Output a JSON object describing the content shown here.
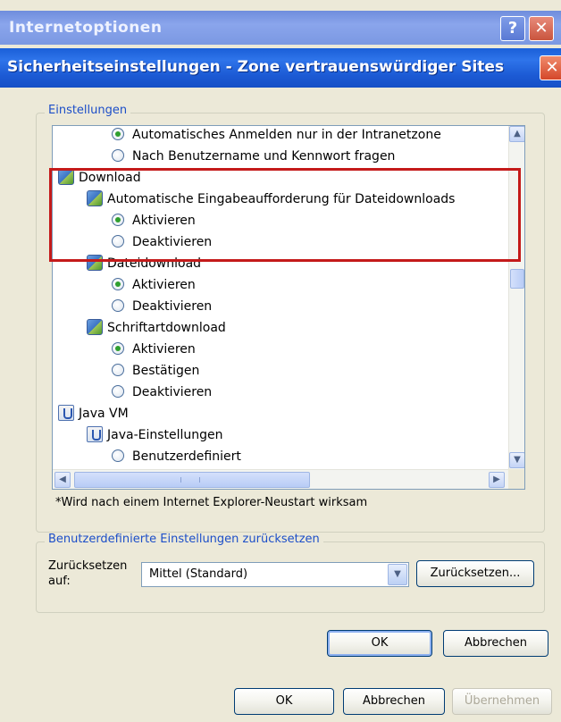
{
  "outer_window": {
    "title": "Internetoptionen",
    "help_label": "?",
    "close_label": "✕"
  },
  "dialog": {
    "title": "Sicherheitseinstellungen - Zone vertrauenswürdiger Sites",
    "close_label": "✕"
  },
  "settings_group": {
    "label": "Einstellungen",
    "rows": [
      {
        "kind": "radio",
        "checked": true,
        "label": "Automatisches Anmelden nur in der Intranetzone"
      },
      {
        "kind": "radio",
        "checked": false,
        "label": "Nach Benutzername und Kennwort fragen"
      },
      {
        "kind": "category",
        "icon": "settings-gear-icon",
        "label": "Download"
      },
      {
        "kind": "setting",
        "icon": "settings-gear-icon",
        "label": "Automatische Eingabeaufforderung für Dateidownloads"
      },
      {
        "kind": "radio",
        "checked": true,
        "label": "Aktivieren"
      },
      {
        "kind": "radio",
        "checked": false,
        "label": "Deaktivieren"
      },
      {
        "kind": "setting",
        "icon": "settings-gear-icon",
        "label": "Dateidownload"
      },
      {
        "kind": "radio",
        "checked": true,
        "label": "Aktivieren"
      },
      {
        "kind": "radio",
        "checked": false,
        "label": "Deaktivieren"
      },
      {
        "kind": "setting",
        "icon": "settings-gear-icon",
        "label": "Schriftartdownload"
      },
      {
        "kind": "radio",
        "checked": true,
        "label": "Aktivieren"
      },
      {
        "kind": "radio",
        "checked": false,
        "label": "Bestätigen"
      },
      {
        "kind": "radio",
        "checked": false,
        "label": "Deaktivieren"
      },
      {
        "kind": "category",
        "icon": "java-cup-icon",
        "label": "Java VM"
      },
      {
        "kind": "setting",
        "icon": "java-cup-icon",
        "label": "Java-Einstellungen"
      },
      {
        "kind": "radio",
        "checked": false,
        "label": "Benutzerdefiniert"
      }
    ],
    "note": "*Wird nach einem Internet Explorer-Neustart wirksam",
    "scroll_up": "▲",
    "scroll_down": "▼",
    "scroll_left": "◀",
    "scroll_right": "▶"
  },
  "reset_group": {
    "label": "Benutzerdefinierte Einstellungen zurücksetzen",
    "reset_to_label": "Zurücksetzen auf:",
    "select_value": "Mittel (Standard)",
    "select_arrow": "▼",
    "reset_button": "Zurücksetzen..."
  },
  "dialog_buttons": {
    "ok": "OK",
    "cancel": "Abbrechen"
  },
  "outer_buttons": {
    "ok": "OK",
    "cancel": "Abbrechen",
    "apply": "Übernehmen"
  },
  "colors": {
    "highlight_border": "#c41a1a",
    "title_bar_active": "#1c5ad4",
    "group_label": "#1c4ec8"
  }
}
